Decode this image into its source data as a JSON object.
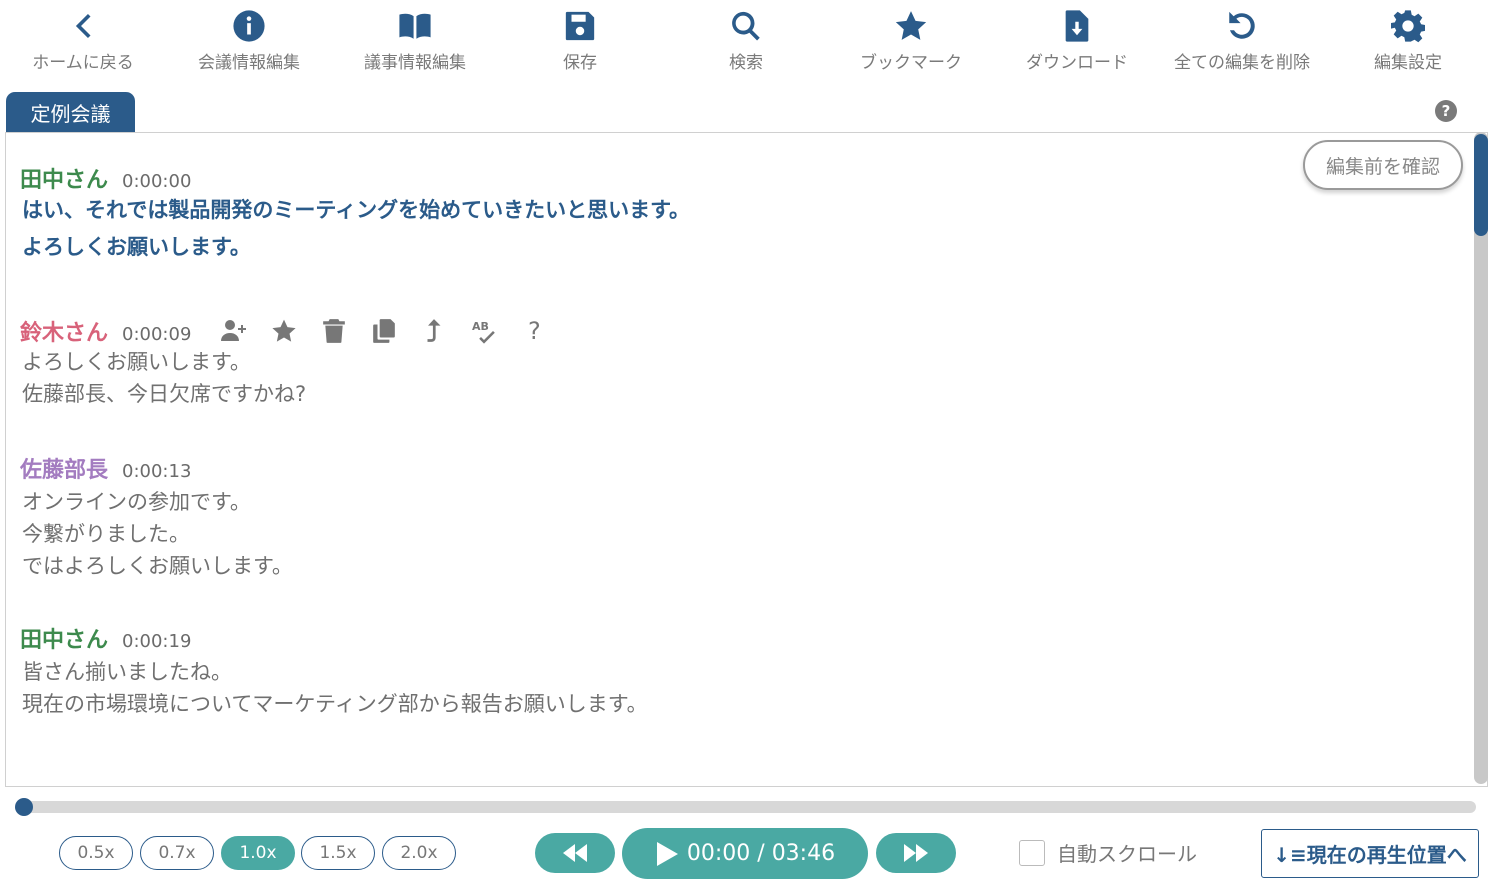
{
  "toolbar": {
    "items": [
      {
        "label": "ホームに戻る",
        "icon": "chevron-left-icon"
      },
      {
        "label": "会議情報編集",
        "icon": "info-icon"
      },
      {
        "label": "議事情報編集",
        "icon": "book-icon"
      },
      {
        "label": "保存",
        "icon": "save-icon"
      },
      {
        "label": "検索",
        "icon": "search-icon"
      },
      {
        "label": "ブックマーク",
        "icon": "star-icon"
      },
      {
        "label": "ダウンロード",
        "icon": "download-file-icon"
      },
      {
        "label": "全ての編集を削除",
        "icon": "undo-icon"
      },
      {
        "label": "編集設定",
        "icon": "gear-icon"
      }
    ]
  },
  "tab": {
    "label": "定例会議"
  },
  "help": {
    "label": "?"
  },
  "compare_button": {
    "label": "編集前を確認"
  },
  "transcript": [
    {
      "speaker": "田中さん",
      "time": "0:00:00",
      "text": "はい、それでは製品開発のミーティングを始めていきたいと思います。\nよろしくお願いします。",
      "color": "#3d8a4d"
    },
    {
      "speaker": "鈴木さん",
      "time": "0:00:09",
      "text": "よろしくお願いします。\n佐藤部長、今日欠席ですかね?",
      "color": "#d8627a"
    },
    {
      "speaker": "佐藤部長",
      "time": "0:00:13",
      "text": "オンラインの参加です。\n今繋がりました。\nではよろしくお願いします。",
      "color": "#a37cc0"
    },
    {
      "speaker": "田中さん",
      "time": "0:00:19",
      "text": "皆さん揃いましたね。\n現在の市場環境についてマーケティング部から報告お願いします。",
      "color": "#3d8a4d"
    }
  ],
  "row_tools": {
    "help_label": "?",
    "spellcheck_label": "AB"
  },
  "player": {
    "progress": 0.0,
    "speeds": [
      "0.5x",
      "0.7x",
      "1.0x",
      "1.5x",
      "2.0x"
    ],
    "selected_speed": "1.0x",
    "time_display": "00:00 / 03:46",
    "accent_color": "#4aa9a3"
  },
  "auto_scroll": {
    "label": "自動スクロール",
    "checked": false
  },
  "jump_button": {
    "label": "↓≡現在の再生位置へ"
  },
  "colors": {
    "primary": "#2b5b8a",
    "accent": "#4aa9a3"
  }
}
